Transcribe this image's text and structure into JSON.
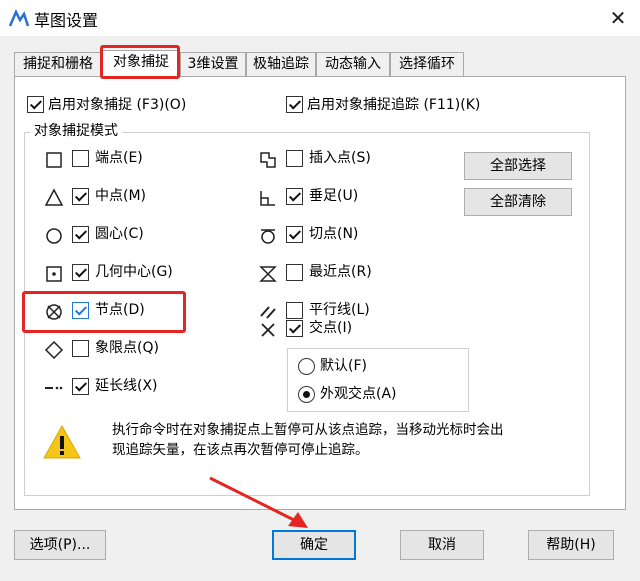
{
  "window": {
    "title": "草图设置",
    "close_glyph": "✕"
  },
  "tabs": [
    {
      "label": "捕捉和栅格"
    },
    {
      "label": "对象捕捉",
      "active": true
    },
    {
      "label": "3维设置"
    },
    {
      "label": "极轴追踪"
    },
    {
      "label": "动态输入"
    },
    {
      "label": "选择循环"
    }
  ],
  "top_options": {
    "enable_snap": {
      "label": "启用对象捕捉 (F3)(O)",
      "checked": true
    },
    "enable_tracking": {
      "label": "启用对象捕捉追踪 (F11)(K)",
      "checked": true
    }
  },
  "modes_group": {
    "title": "对象捕捉模式"
  },
  "modes_left": [
    {
      "label": "端点(E)",
      "checked": false,
      "icon": "square-marker-icon"
    },
    {
      "label": "中点(M)",
      "checked": true,
      "icon": "triangle-marker-icon"
    },
    {
      "label": "圆心(C)",
      "checked": true,
      "icon": "circle-marker-icon"
    },
    {
      "label": "几何中心(G)",
      "checked": true,
      "icon": "dotted-square-marker-icon"
    },
    {
      "label": "节点(D)",
      "checked": true,
      "icon": "node-marker-icon"
    },
    {
      "label": "象限点(Q)",
      "checked": false,
      "icon": "diamond-marker-icon"
    },
    {
      "label": "延长线(X)",
      "checked": true,
      "icon": "extension-marker-icon"
    }
  ],
  "modes_right": [
    {
      "label": "插入点(S)",
      "checked": false,
      "icon": "insert-marker-icon"
    },
    {
      "label": "垂足(U)",
      "checked": true,
      "icon": "perpendicular-marker-icon"
    },
    {
      "label": "切点(N)",
      "checked": true,
      "icon": "tangent-marker-icon"
    },
    {
      "label": "最近点(R)",
      "checked": false,
      "icon": "nearest-marker-icon"
    },
    {
      "label": "平行线(L)",
      "checked": false,
      "icon": "parallel-marker-icon"
    },
    {
      "label": "交点(I)",
      "checked": true,
      "icon": "intersection-marker-icon"
    }
  ],
  "intersection_options": [
    {
      "label": "默认(F)",
      "selected": false
    },
    {
      "label": "外观交点(A)",
      "selected": true
    }
  ],
  "side_buttons": {
    "select_all": "全部选择",
    "clear_all": "全部清除"
  },
  "hint": {
    "icon": "warning-icon",
    "line1": "执行命令时在对象捕捉点上暂停可从该点追踪，当移动光标时会出",
    "line2": "现追踪矢量，在该点再次暂停可停止追踪。"
  },
  "footer": {
    "options": "选项(P)...",
    "ok": "确定",
    "cancel": "取消",
    "help": "帮助(H)"
  },
  "colors": {
    "highlight": "#e52521",
    "accent": "#0078d7",
    "warning": "#f5c518"
  }
}
